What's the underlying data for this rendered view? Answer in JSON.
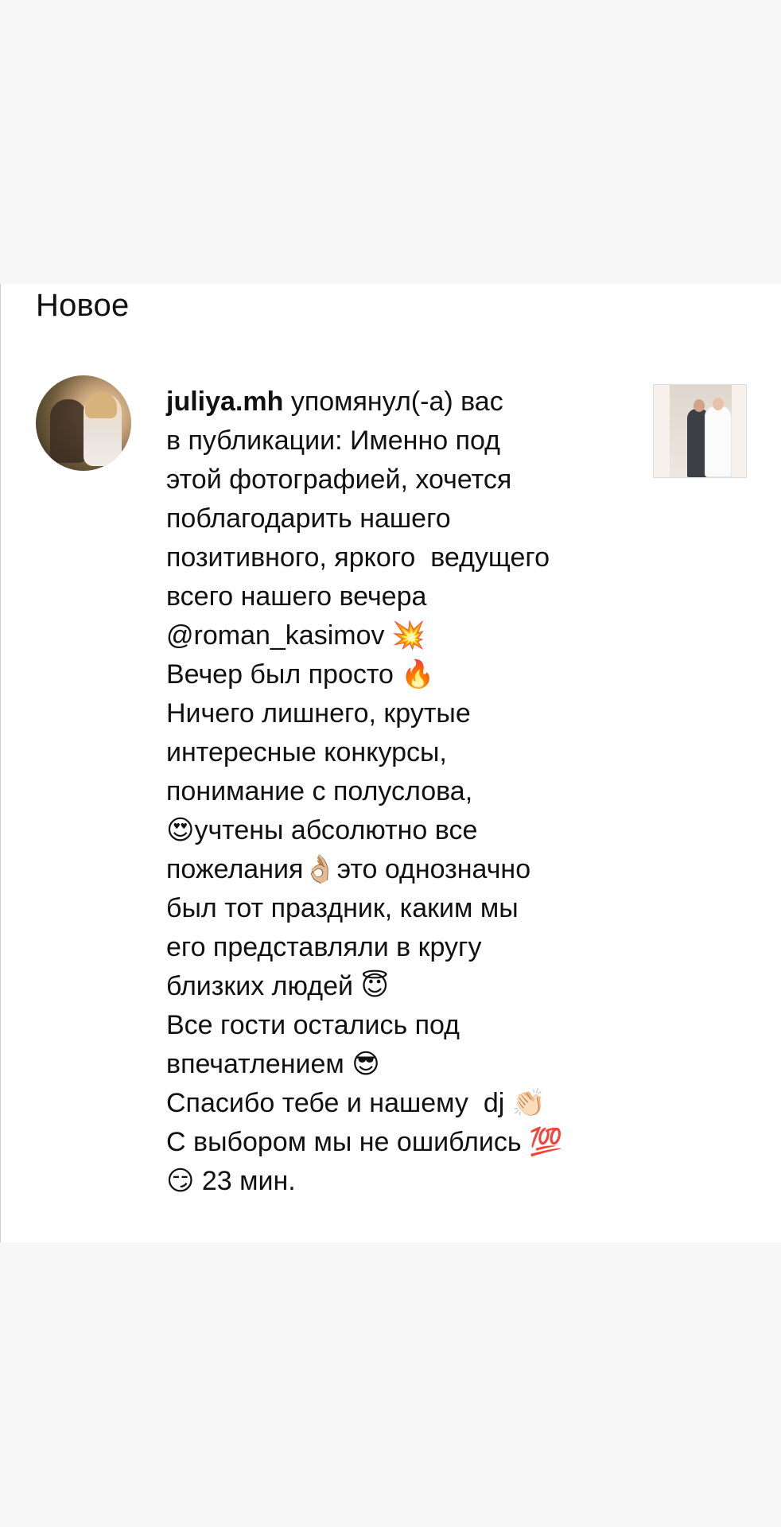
{
  "header": {
    "section_title": "Новое"
  },
  "notification": {
    "username": "juliya.mh",
    "text": " упомянул(-а) вас\nв публикации: Именно под\nэтой фотографией, хочется\nпоблагодарить нашего\nпозитивного, яркого  ведущего\nвсего нашего вечера\n@roman_kasimov 💥\nВечер был просто 🔥\nНичего лишнего, крутые\nинтересные конкурсы,\nпонимание с полуслова,\n😍учтены абсолютно все\nпожелания👌🏼это однозначно\nбыл тот праздник, каким мы\nего представляли в кругу\nблизких людей 😇\nВсе гости остались под\nвпечатлением 😎\nСпасибо тебе и нашему  dj 👏🏻\nС выбором мы не ошиблись 💯\n😏 ",
    "time": "23 мин."
  },
  "colors": {
    "page_background": "#f7f7f7",
    "card_background": "#ffffff",
    "text": "#111111"
  },
  "icons": {
    "avatar": "profile-photo",
    "thumbnail": "post-photo-wedding"
  }
}
